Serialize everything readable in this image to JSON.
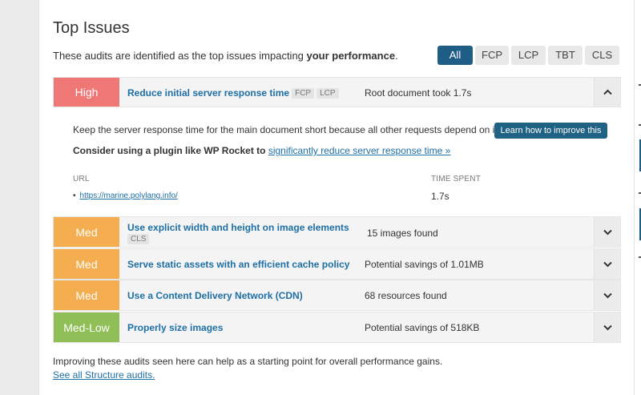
{
  "section": {
    "title": "Top Issues",
    "intro_prefix": "These audits are identified as the top issues impacting ",
    "intro_bold": "your performance",
    "intro_suffix": "."
  },
  "filters": [
    "All",
    "FCP",
    "LCP",
    "TBT",
    "CLS"
  ],
  "filter_active": "All",
  "issues": [
    {
      "severity": "High",
      "title": "Reduce initial server response time",
      "tags": [
        "FCP",
        "LCP"
      ],
      "summary": "Root document took 1.7s",
      "expanded": true
    },
    {
      "severity": "Med",
      "title": "Use explicit width and height on image elements",
      "tags": [
        "CLS"
      ],
      "summary": "15 images found",
      "expanded": false
    },
    {
      "severity": "Med",
      "title": "Serve static assets with an efficient cache policy",
      "tags": [],
      "summary": "Potential savings of 1.01MB",
      "expanded": false
    },
    {
      "severity": "Med",
      "title": "Use a Content Delivery Network (CDN)",
      "tags": [],
      "summary": "68 resources found",
      "expanded": false
    },
    {
      "severity": "Med-Low",
      "title": "Properly size images",
      "tags": [],
      "summary": "Potential savings of 518KB",
      "expanded": false
    }
  ],
  "detail": {
    "description": "Keep the server response time for the main document short because all other requests depend on it.",
    "learn_button": "Learn how to improve this",
    "consider_prefix": "Consider using a plugin like WP Rocket to",
    "consider_link": "significantly reduce server response time »",
    "col_url": "URL",
    "col_time": "TIME SPENT",
    "rows": [
      {
        "url": "https://marine.polylang.info/",
        "time": "1.7s"
      }
    ]
  },
  "footer": {
    "text": "Improving these audits seen here can help as a starting point for overall performance gains.",
    "link": "See all Structure audits."
  },
  "colors": {
    "high": "#ef7876",
    "med": "#f4ae4f",
    "med_low": "#8fbf56",
    "accent": "#1f5d87",
    "link": "#1d6fa5"
  }
}
